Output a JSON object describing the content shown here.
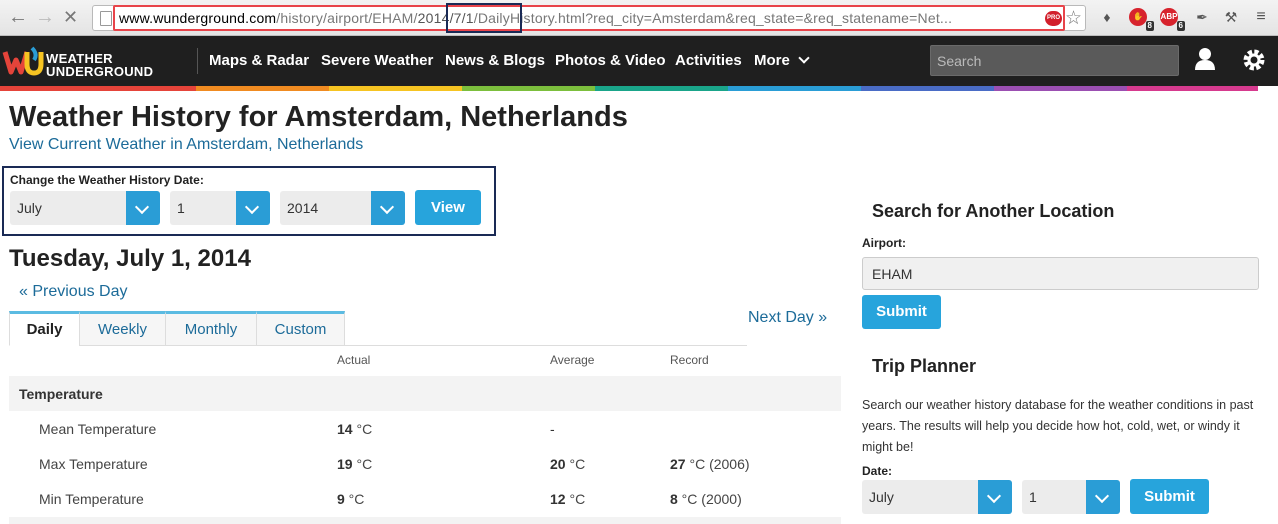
{
  "browser": {
    "url_domain": "www.wunderground.com",
    "url_path_before": "/history/airport/EHAM/",
    "url_date": "2014/7/1",
    "url_path_after": "/DailyHistory.html?req_city=Amsterdam&req_state=&req_statename=Net...",
    "pro_badge": "PRO",
    "ext_abp_label": "ABP",
    "ext_counts": [
      "8",
      "6"
    ]
  },
  "header": {
    "logo_line1": "WEATHER",
    "logo_line2": "UNDERGROUND",
    "nav": [
      "Maps & Radar",
      "Severe Weather",
      "News & Blogs",
      "Photos & Video",
      "Activities",
      "More"
    ],
    "search_placeholder": "Search"
  },
  "colors": {
    "rainbow": [
      "#e5443a",
      "#f08b21",
      "#f6c422",
      "#7cbf3d",
      "#1aa58a",
      "#2a9dd6",
      "#4a6cc6",
      "#9b4fb2",
      "#d63a8e"
    ],
    "accent": "#27a4dc",
    "link": "#1c6b99",
    "highlight_red": "#e8444a",
    "highlight_navy": "#1a2a55"
  },
  "main": {
    "title": "Weather History for Amsterdam, Netherlands",
    "current_link": "View Current Weather in Amsterdam, Netherlands",
    "form_label": "Change the Weather History Date:",
    "month": "July",
    "day": "1",
    "year": "2014",
    "view_button": "View",
    "date_heading": "Tuesday, July 1, 2014",
    "prev_day": "« Previous Day",
    "next_day": "Next Day »",
    "tabs": [
      "Daily",
      "Weekly",
      "Monthly",
      "Custom"
    ],
    "columns": [
      "Actual",
      "Average",
      "Record"
    ],
    "section": "Temperature",
    "rows": [
      {
        "label": "Mean Temperature",
        "actual": "14",
        "actual_unit": " °C",
        "average": "-",
        "average_unit": "",
        "record": "",
        "record_unit": ""
      },
      {
        "label": "Max Temperature",
        "actual": "19",
        "actual_unit": " °C",
        "average": "20",
        "average_unit": " °C",
        "record": "27",
        "record_unit": " °C (2006)"
      },
      {
        "label": "Min Temperature",
        "actual": "9",
        "actual_unit": " °C",
        "average": "12",
        "average_unit": " °C",
        "record": "8",
        "record_unit": " °C (2000)"
      }
    ]
  },
  "sidebar": {
    "search_heading": "Search for Another Location",
    "airport_label": "Airport:",
    "airport_value": "EHAM",
    "submit": "Submit",
    "trip_heading": "Trip Planner",
    "trip_text": "Search our weather history database for the weather conditions in past years. The results will help you decide how hot, cold, wet, or windy it might be!",
    "date_label": "Date:",
    "trip_month": "July",
    "trip_day": "1",
    "trip_submit": "Submit"
  }
}
